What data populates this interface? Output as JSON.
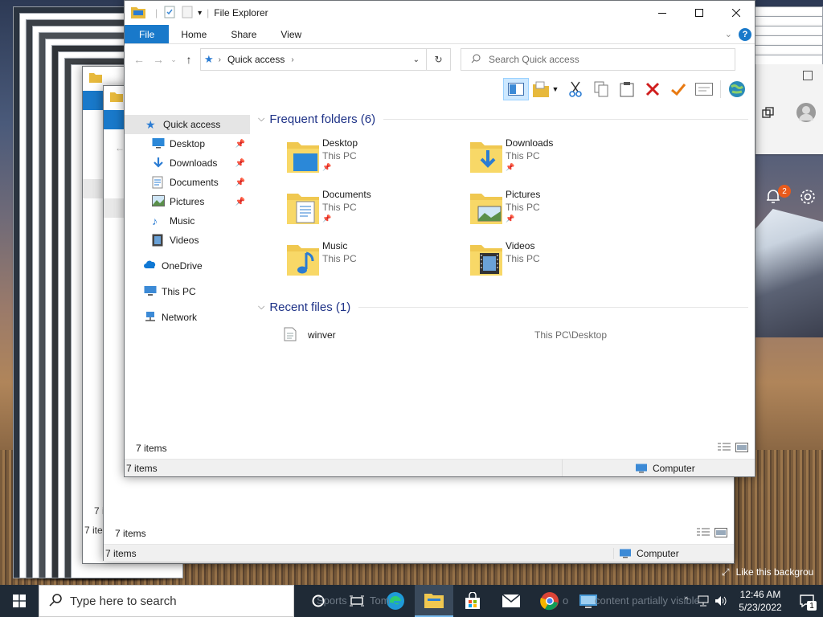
{
  "explorer": {
    "title": "File Explorer",
    "ribbon_tabs": [
      "File",
      "Home",
      "Share",
      "View"
    ],
    "address": {
      "location": "Quick access"
    },
    "search": {
      "placeholder": "Search Quick access"
    },
    "nav": {
      "quick_access": "Quick access",
      "pinned": [
        {
          "label": "Desktop",
          "icon": "desktop-icon"
        },
        {
          "label": "Downloads",
          "icon": "downloads-icon"
        },
        {
          "label": "Documents",
          "icon": "documents-icon"
        },
        {
          "label": "Pictures",
          "icon": "pictures-icon"
        }
      ],
      "unpinned": [
        {
          "label": "Music",
          "icon": "music-icon"
        },
        {
          "label": "Videos",
          "icon": "videos-icon"
        }
      ],
      "onedrive": "OneDrive",
      "this_pc": "This PC",
      "network": "Network"
    },
    "frequent": {
      "header": "Frequent folders (6)",
      "items": [
        {
          "name": "Desktop",
          "location": "This PC"
        },
        {
          "name": "Downloads",
          "location": "This PC"
        },
        {
          "name": "Documents",
          "location": "This PC"
        },
        {
          "name": "Pictures",
          "location": "This PC"
        },
        {
          "name": "Music",
          "location": "This PC"
        },
        {
          "name": "Videos",
          "location": "This PC"
        }
      ]
    },
    "recent": {
      "header": "Recent files (1)",
      "items": [
        {
          "name": "winver",
          "path": "This PC\\Desktop"
        }
      ]
    },
    "inner_status": "7 items",
    "status_left": "7 items",
    "status_right": "Computer"
  },
  "back_window": {
    "inner_status": "7 items",
    "status_left": "7 items",
    "status_right": "Computer",
    "edge_labels": [
      "7 it",
      "7 ite"
    ]
  },
  "right_app": {
    "notification_count": "2",
    "spotlight_text": "Like this backgrou"
  },
  "taskbar": {
    "search_placeholder": "Type here to search",
    "time": "12:46 AM",
    "date": "5/23/2022",
    "notification_count": "1",
    "behind_text_1": "Sports",
    "behind_text_2": "Tom",
    "behind_text_3": "o",
    "behind_text_4": "content partially visible"
  },
  "colors": {
    "accent": "#1979ca",
    "taskbar": "#1f2a36",
    "group_header": "#1e3287"
  }
}
